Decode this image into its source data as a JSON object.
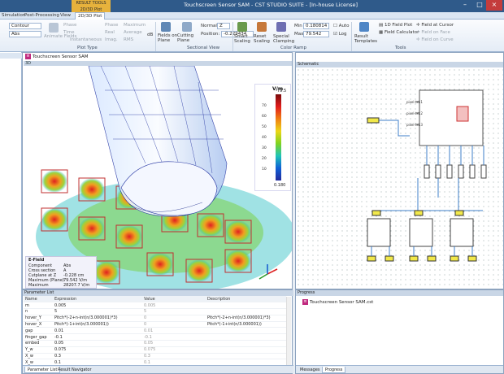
{
  "window": {
    "context_tab": [
      "RESULT TOOLS",
      "2D/3D Plot"
    ],
    "title": "Touchscreen Sensor SAM - CST STUDIO SUITE - [In-house License]"
  },
  "menu_tabs": [
    "Simulation",
    "Post-Processing",
    "View",
    "2D/3D Plot"
  ],
  "ribbon": {
    "plot_type": {
      "mode": "Contour",
      "component": "Abs",
      "animate": "Animate Fields",
      "phase": "Phase",
      "time": "Time",
      "instantaneous": "Instantaneous",
      "phase_b": "Phase",
      "real": "Real",
      "imag": "Imag.",
      "maximum": "Maximum",
      "average": "Average",
      "rms": "RMS",
      "db": "dB",
      "label": "Plot Type"
    },
    "sectional_view": {
      "fields_on_plane": "Fields on Plane",
      "cutting_plane": "Cutting Plane",
      "normal_label": "Normal:",
      "normal_value": "Z",
      "position_label": "Position:",
      "position_value": "-0.229434",
      "label": "Sectional View"
    },
    "color_ramp": {
      "smart_scaling": "Smart Scaling",
      "reset_scaling": "Reset Scaling",
      "special_clamping": "Special Clamping",
      "min_label": "Min",
      "min_value": "0.180814",
      "max_label": "Max",
      "max_value": "79.542",
      "auto": "Auto",
      "log": "Log",
      "label": "Color Ramp"
    },
    "tools": {
      "result_templates": "Result Templates",
      "field_1d": "1D Field Plot",
      "field_calc": "Field Calculator",
      "field_at_cursor": "Field at Cursor",
      "field_on_face": "Field on Face",
      "field_on_curve": "Field on Curve",
      "label": "Tools"
    }
  },
  "view3d": {
    "tab": "Touchscreen Sensor SAM",
    "header": "3D",
    "legend": {
      "unit": "V/m",
      "max": "79.5",
      "min": "0.180",
      "ticks": [
        "70",
        "60",
        "50",
        "40",
        "30",
        "20",
        "10"
      ]
    },
    "info": {
      "title": "E-Field",
      "rows": [
        [
          "Component",
          "Abs"
        ],
        [
          "Cross section",
          "A"
        ],
        [
          "Cutplane at Z",
          "-0.228 cm"
        ],
        [
          "Maximum (Plane)",
          "79.542 V/m"
        ],
        [
          "Maximum",
          "28207.7 V/m"
        ]
      ]
    }
  },
  "schematic": {
    "tab": "Schematic",
    "probe_labels": [
      "pixel-tst.1",
      "pixel-tst.2",
      "pixel-tst.3"
    ]
  },
  "parameter_list": {
    "title": "Parameter List",
    "columns": [
      "Name",
      "Expression",
      "Value",
      "Description"
    ],
    "rows": [
      [
        "m",
        "0.005",
        "0.005",
        ""
      ],
      [
        "n",
        "5",
        "5",
        ""
      ],
      [
        "hover_Y",
        "Pitch*(-2+n-int(n/3.000001)*3)",
        "0",
        "Pitch*(-2+n-int(n/3.000001)*3)"
      ],
      [
        "hover_X",
        "Pitch*(-1+int(n/3.000001))",
        "0",
        "Pitch*(-1+int(n/3.000001))"
      ],
      [
        "gap",
        "0.01",
        "0.01",
        ""
      ],
      [
        "finger_gap",
        "-0.1",
        "-0.1",
        ""
      ],
      [
        "embed",
        "0.05",
        "0.05",
        ""
      ],
      [
        "Y_w",
        "0.075",
        "0.075",
        ""
      ],
      [
        "X_w",
        "0.3",
        "0.3",
        ""
      ],
      [
        "X_w",
        "0.1",
        "0.1",
        ""
      ]
    ],
    "bottom_tabs": [
      "Parameter List",
      "Result Navigator"
    ]
  },
  "progress": {
    "title": "Progress",
    "item": "Touchscreen Sensor SAM.cst",
    "bottom_tabs": [
      "Messages",
      "Progress"
    ]
  },
  "colors": {
    "title_bar": "#2f5a8a",
    "context_tab": "#e7b23c",
    "accent": "#c0287e"
  }
}
